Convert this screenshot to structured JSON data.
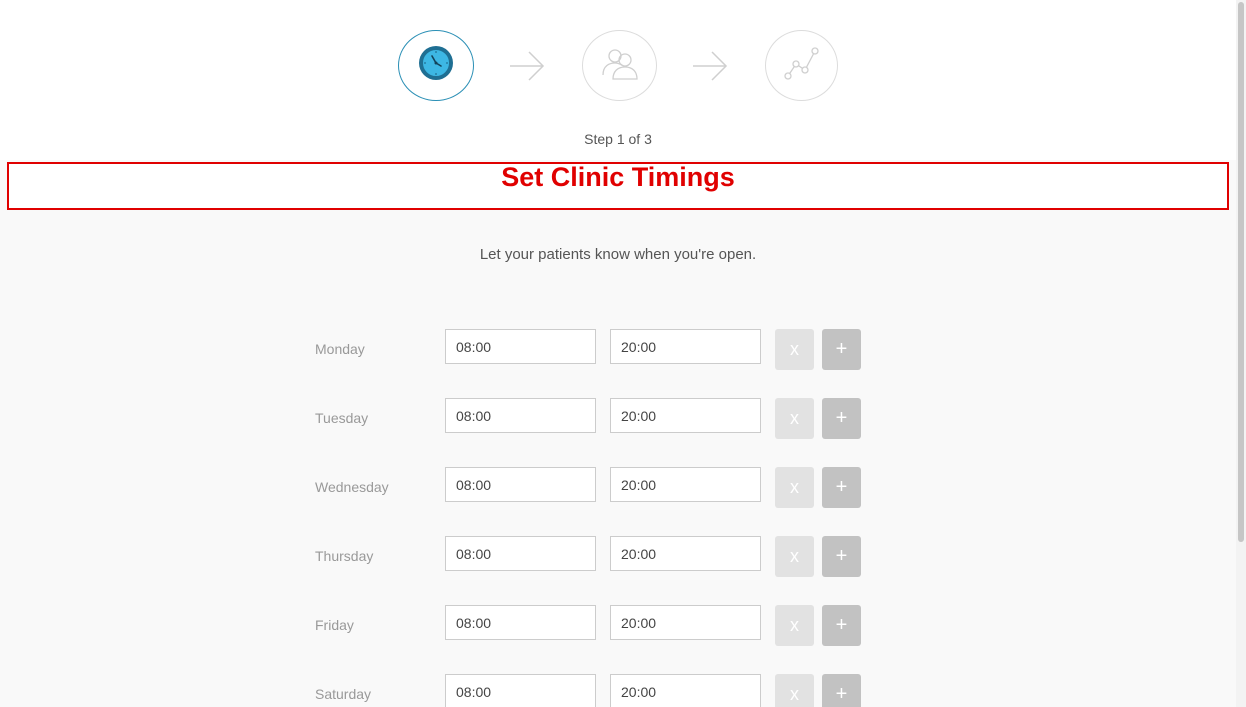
{
  "wizard": {
    "step_text": "Step 1 of 3",
    "steps": [
      {
        "icon": "clock-icon",
        "active": true
      },
      {
        "icon": "users-icon",
        "active": false
      },
      {
        "icon": "analytics-icon",
        "active": false
      }
    ]
  },
  "heading": {
    "title": "Set Clinic Timings",
    "subtitle": "Let your patients know when you're open."
  },
  "schedule": {
    "days": [
      {
        "day": "Monday",
        "open": "08:00",
        "close": "20:00",
        "remove_label": "x",
        "add_label": "+"
      },
      {
        "day": "Tuesday",
        "open": "08:00",
        "close": "20:00",
        "remove_label": "x",
        "add_label": "+"
      },
      {
        "day": "Wednesday",
        "open": "08:00",
        "close": "20:00",
        "remove_label": "x",
        "add_label": "+"
      },
      {
        "day": "Thursday",
        "open": "08:00",
        "close": "20:00",
        "remove_label": "x",
        "add_label": "+"
      },
      {
        "day": "Friday",
        "open": "08:00",
        "close": "20:00",
        "remove_label": "x",
        "add_label": "+"
      },
      {
        "day": "Saturday",
        "open": "08:00",
        "close": "20:00",
        "remove_label": "x",
        "add_label": "+"
      }
    ]
  },
  "colors": {
    "accent": "#2a8fb5",
    "title": "#e00000",
    "background": "#f9f9f9"
  }
}
